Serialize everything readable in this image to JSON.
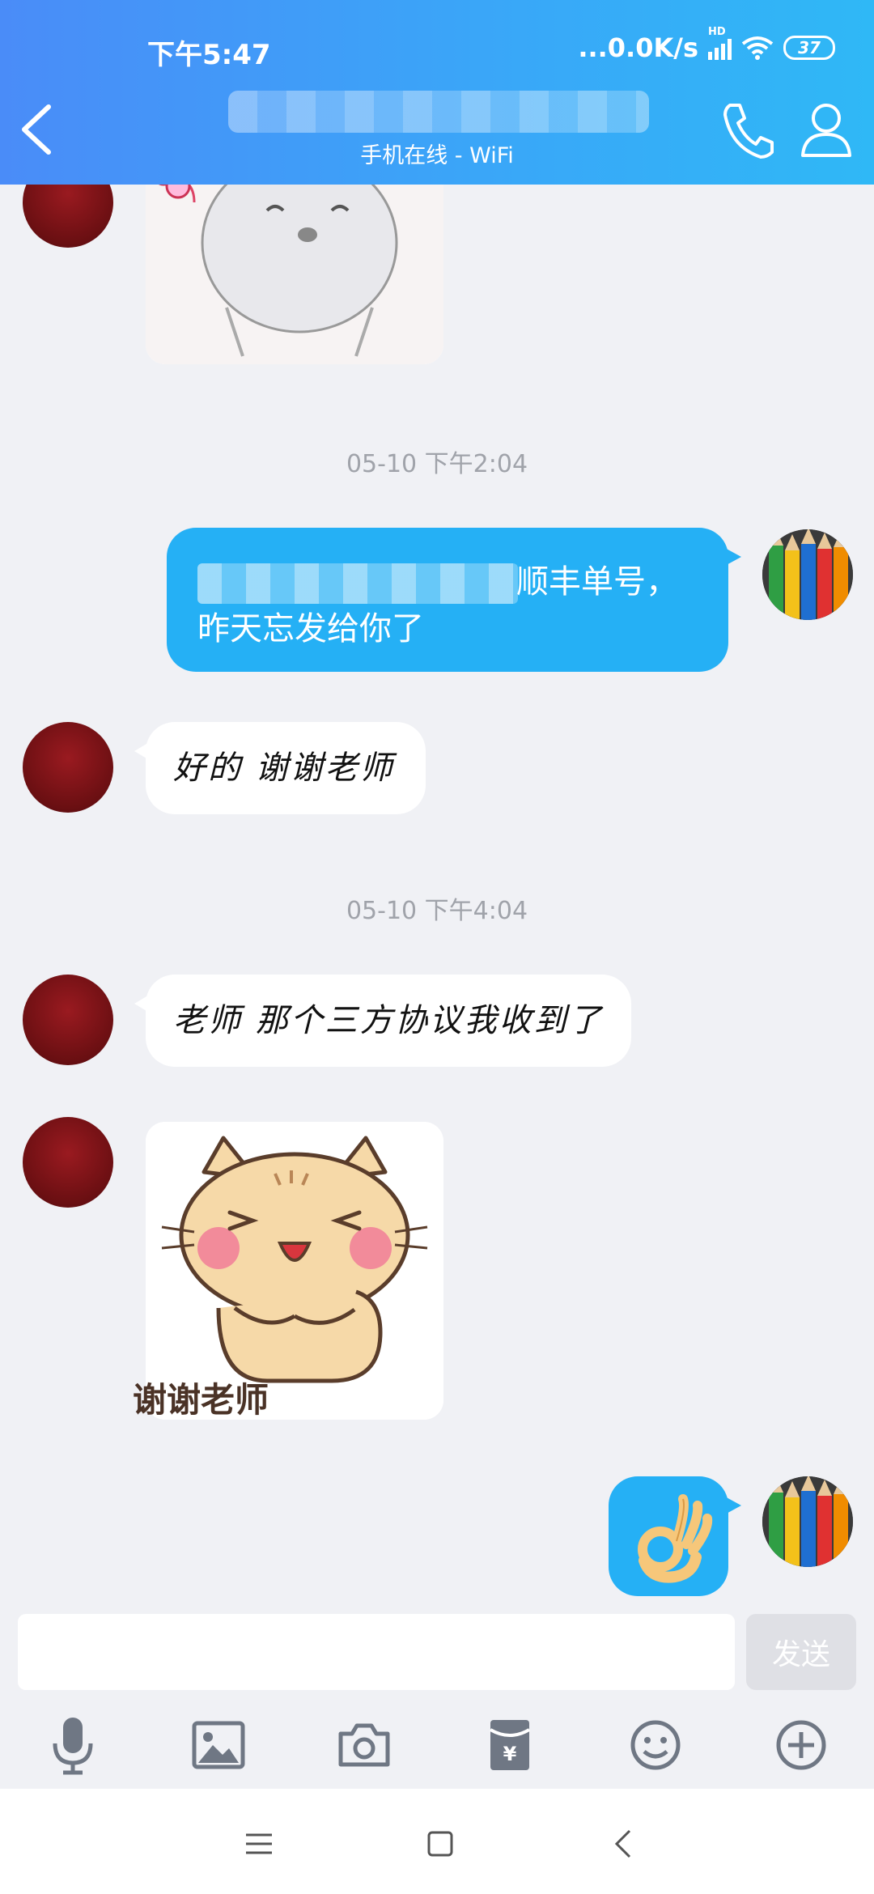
{
  "status_bar": {
    "time": "下午5:47",
    "network_speed": "...0.0K/s",
    "signal_label": "HD",
    "battery_level": "37"
  },
  "header": {
    "subtitle": "手机在线 - WiFi",
    "icons": {
      "back": "back-chevron-icon",
      "call": "phone-icon",
      "profile": "person-icon"
    }
  },
  "colors": {
    "header_gradient_start": "#4a8cf8",
    "header_gradient_end": "#2fb8f6",
    "self_bubble": "#25b0f5",
    "peer_bubble": "#ffffff",
    "background": "#f0f1f5"
  },
  "messages": [
    {
      "sender": "peer",
      "type": "sticker",
      "sticker": "hamster-with-flower-sticker"
    },
    {
      "type": "timestamp",
      "text": "05-10 下午2:04"
    },
    {
      "sender": "self",
      "type": "text",
      "line1": "顺丰单号，",
      "line2": "昨天忘发给你了"
    },
    {
      "sender": "peer",
      "type": "text",
      "text": "好的 谢谢老师"
    },
    {
      "type": "timestamp",
      "text": "05-10 下午4:04"
    },
    {
      "sender": "peer",
      "type": "text",
      "text": "老师 那个三方协议我收到了"
    },
    {
      "sender": "peer",
      "type": "sticker",
      "sticker": "cat-thanks-sticker",
      "caption": "谢谢老师"
    },
    {
      "sender": "self",
      "type": "emoji",
      "emoji": "ok-hand"
    }
  ],
  "input": {
    "placeholder": "",
    "send_label": "发送"
  },
  "toolbar": [
    "microphone-icon",
    "image-icon",
    "camera-icon",
    "red-packet-icon",
    "emoji-icon",
    "plus-icon"
  ],
  "navbar": [
    "menu-icon",
    "home-square-icon",
    "back-icon"
  ]
}
